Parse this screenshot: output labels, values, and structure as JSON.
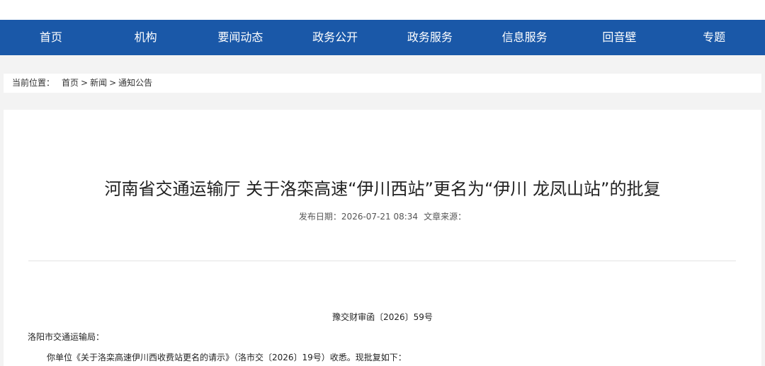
{
  "nav": {
    "items": [
      {
        "label": "首页"
      },
      {
        "label": "机构"
      },
      {
        "label": "要闻动态"
      },
      {
        "label": "政务公开"
      },
      {
        "label": "政务服务"
      },
      {
        "label": "信息服务"
      },
      {
        "label": "回音壁"
      },
      {
        "label": "专题"
      }
    ],
    "background_color": "#1a58a8"
  },
  "breadcrumb": {
    "label": "当前位置：",
    "items": [
      "首页",
      "新闻",
      "通知公告"
    ],
    "separator": ">"
  },
  "article": {
    "title": "河南省交通运输厅 关于洛栾高速“伊川西站”更名为“伊川 龙凤山站”的批复",
    "publish_label": "发布日期：",
    "publish_date": "2026-07-21 08:34",
    "source_label": "文章来源：",
    "source_value": "",
    "doc_number": "豫交财审函〔2026〕59号",
    "addressee": "洛阳市交通运输局：",
    "paragraph1": "你单位《关于洛栾高速伊川西收费站更名的请示》（洛市交〔2026〕19号）收悉。现批复如下："
  }
}
